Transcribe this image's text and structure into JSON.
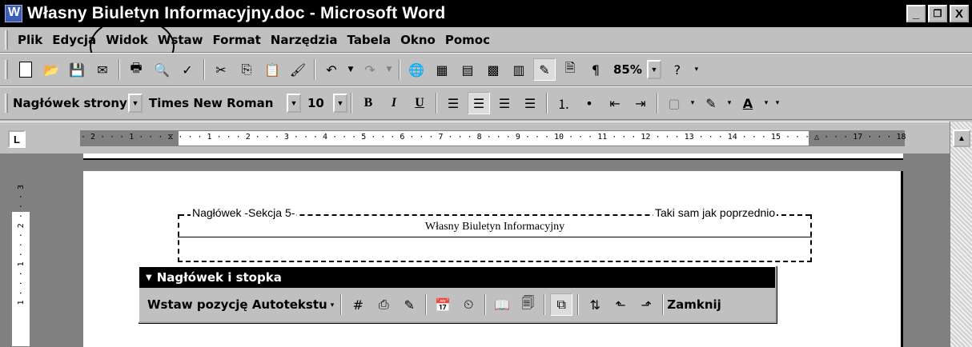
{
  "window": {
    "title": "Własny Biuletyn Informacyjny.doc - Microsoft Word",
    "buttons": {
      "minimize": "_",
      "restore": "🗗",
      "close": "X"
    }
  },
  "menu": {
    "items": [
      {
        "label": "Plik"
      },
      {
        "label": "Edycja"
      },
      {
        "label": "Widok"
      },
      {
        "label": "Wstaw"
      },
      {
        "label": "Format"
      },
      {
        "label": "Narzędzia"
      },
      {
        "label": "Tabela"
      },
      {
        "label": "Okno"
      },
      {
        "label": "Pomoc"
      }
    ]
  },
  "standard_toolbar": {
    "zoom": "85%",
    "icons": [
      "new-document-icon",
      "open-folder-icon",
      "save-icon",
      "email-icon",
      "print-icon",
      "print-preview-icon",
      "spelling-icon",
      "cut-icon",
      "copy-icon",
      "paste-icon",
      "format-painter-icon",
      "undo-icon",
      "redo-icon",
      "hyperlink-icon",
      "tables-borders-icon",
      "insert-table-icon",
      "insert-excel-icon",
      "columns-icon",
      "drawing-icon",
      "document-map-icon",
      "show-hide-icon",
      "help-icon"
    ]
  },
  "formatting_toolbar": {
    "style": "Nagłówek strony",
    "font": "Times New Roman",
    "size": "10",
    "bold": "B",
    "italic": "I",
    "underline": "U"
  },
  "ruler": {
    "tab_selector": "L",
    "scale_text": "· 2 · · · 1 · · · ⧖ · · · 1 · · · 2 · · · 3 · · · 4 · · · 5 · · · 6 · · · 7 · · · 8 · · · 9 · · · 10 · · · 11 · · · 12 · · · 13 · · · 14 · · · 15 · · · △ · · · 17 · · · 18 ·",
    "vertical_scale_text": "1 · · · 1 · · · 2 · · · 3"
  },
  "document": {
    "header_label_left": "Nagłówek -Sekcja 5-",
    "header_label_right": "Taki sam jak poprzednio",
    "header_text": "Własny Biuletyn Informacyjny"
  },
  "header_footer_toolbar": {
    "title": "Nagłówek i stopka",
    "autotext_label": "Wstaw pozycję Autotekstu",
    "close_label": "Zamknij"
  }
}
